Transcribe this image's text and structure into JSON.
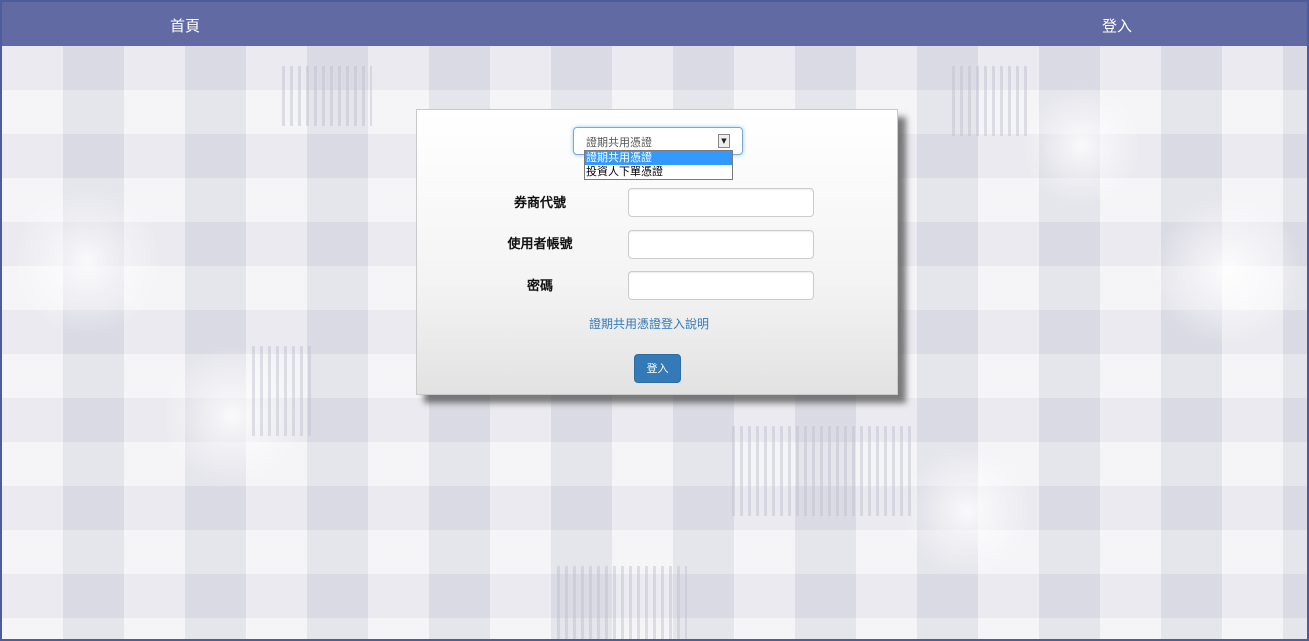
{
  "navbar": {
    "home_label": "首頁",
    "login_label": "登入",
    "background_color": "#616aa2"
  },
  "login_form": {
    "certificate_select": {
      "selected_value": "證期共用憑證",
      "options": [
        "證期共用憑證",
        "投資人下單憑證"
      ],
      "highlighted_option_index": 0,
      "dropdown_open": true
    },
    "fields": [
      {
        "label": "券商代號",
        "value": ""
      },
      {
        "label": "使用者帳號",
        "value": ""
      },
      {
        "label": "密碼",
        "value": ""
      }
    ],
    "help_link_text": "證期共用憑證登入說明",
    "submit_label": "登入",
    "accent_color": "#337ab7"
  }
}
